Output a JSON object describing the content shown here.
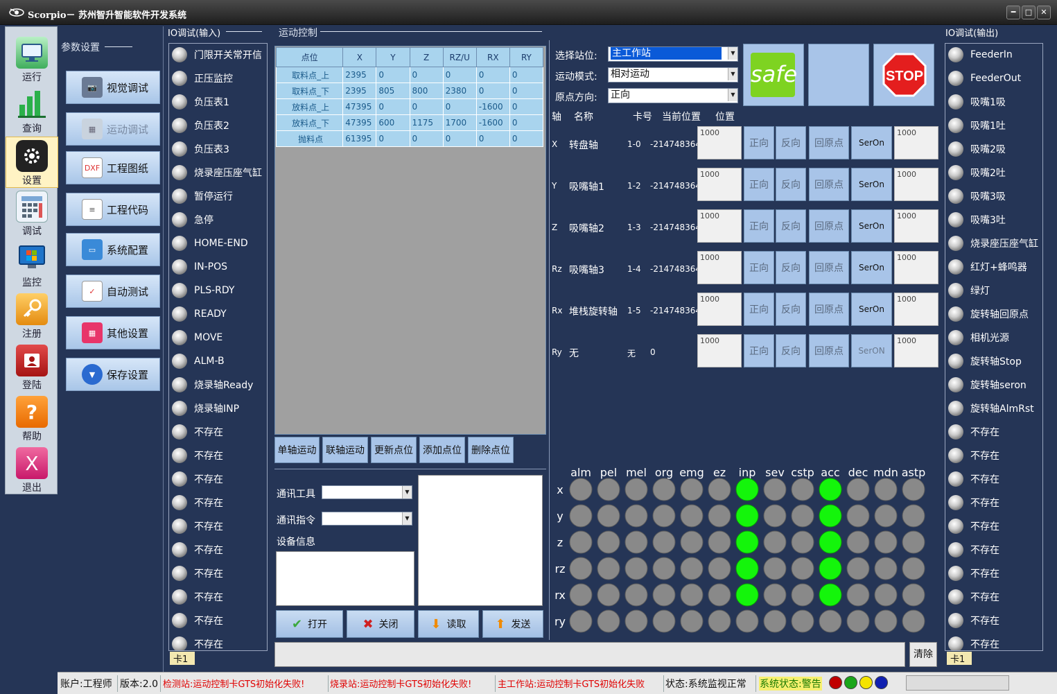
{
  "window": {
    "title": "Scorpio－ 苏州智升智能软件开发系统",
    "min": "━",
    "max": "□",
    "close": "✕"
  },
  "nav": [
    {
      "label": "运行",
      "icon": "monitor-icon"
    },
    {
      "label": "查询",
      "icon": "bar-chart-icon"
    },
    {
      "label": "设置",
      "icon": "gear-icon",
      "active": true
    },
    {
      "label": "调试",
      "icon": "calculator-icon"
    },
    {
      "label": "监控",
      "icon": "windows-monitor-icon"
    },
    {
      "label": "注册",
      "icon": "key-icon"
    },
    {
      "label": "登陆",
      "icon": "login-icon"
    },
    {
      "label": "帮助",
      "icon": "help-icon"
    },
    {
      "label": "退出",
      "icon": "exit-icon"
    }
  ],
  "params": {
    "title": "参数设置",
    "buttons": [
      "视觉调试",
      "运动调试",
      "工程图纸",
      "工程代码",
      "系统配置",
      "自动测试",
      "其他设置",
      "保存设置"
    ]
  },
  "io_in": {
    "title": "IO调试(输入)",
    "items": [
      "门限开关常开信",
      "正压监控",
      "负压表1",
      "负压表2",
      "负压表3",
      "烧录座压座气缸",
      "暂停运行",
      "急停",
      "HOME-END",
      "IN-POS",
      "PLS-RDY",
      "READY",
      "MOVE",
      "ALM-B",
      "烧录轴Ready",
      "烧录轴INP",
      "不存在",
      "不存在",
      "不存在",
      "不存在",
      "不存在",
      "不存在",
      "不存在",
      "不存在",
      "不存在",
      "不存在"
    ],
    "card": "卡1"
  },
  "motion": {
    "title": "运动控制",
    "table": {
      "headers": [
        "点位",
        "X",
        "Y",
        "Z",
        "RZ/U",
        "RX",
        "RY"
      ],
      "rows": [
        [
          "取料点_上",
          "2395",
          "0",
          "0",
          "0",
          "0",
          "0"
        ],
        [
          "取料点_下",
          "2395",
          "805",
          "800",
          "2380",
          "0",
          "0"
        ],
        [
          "放料点_上",
          "47395",
          "0",
          "0",
          "0",
          "-1600",
          "0"
        ],
        [
          "放料点_下",
          "47395",
          "600",
          "1175",
          "1700",
          "-1600",
          "0"
        ],
        [
          "抛料点",
          "61395",
          "0",
          "0",
          "0",
          "0",
          "0"
        ]
      ]
    },
    "buttons": [
      "单轴运动",
      "联轴运动",
      "更新点位",
      "添加点位",
      "删除点位"
    ]
  },
  "comm": {
    "tool_label": "通讯工具",
    "cmd_label": "通讯指令",
    "device_label": "设备信息",
    "tool_value": "",
    "cmd_value": "",
    "open": "打开",
    "close": "关闭",
    "read": "读取",
    "send": "发送"
  },
  "station": {
    "select_label": "选择站位:",
    "select_value": "主工作站",
    "mode_label": "运动模式:",
    "mode_value": "相对运动",
    "dir_label": "原点方向:",
    "dir_value": "正向",
    "safe_text": "safe",
    "stop_text": "STOP"
  },
  "axes": {
    "headers": [
      "轴",
      "名称",
      "卡号",
      "当前位置",
      "位置"
    ],
    "rows": [
      {
        "axis": "X",
        "name": "转盘轴",
        "card": "1-0",
        "pos": "-214748364",
        "val": "1000",
        "fwd": "正向",
        "rev": "反向",
        "home": "回原点",
        "seron": "SerOn",
        "val2": "1000"
      },
      {
        "axis": "Y",
        "name": "吸嘴轴1",
        "card": "1-2",
        "pos": "-214748364",
        "val": "1000",
        "fwd": "正向",
        "rev": "反向",
        "home": "回原点",
        "seron": "SerOn",
        "val2": "1000"
      },
      {
        "axis": "Z",
        "name": "吸嘴轴2",
        "card": "1-3",
        "pos": "-214748364",
        "val": "1000",
        "fwd": "正向",
        "rev": "反向",
        "home": "回原点",
        "seron": "SerOn",
        "val2": "1000"
      },
      {
        "axis": "Rz",
        "name": "吸嘴轴3",
        "card": "1-4",
        "pos": "-214748364",
        "val": "1000",
        "fwd": "正向",
        "rev": "反向",
        "home": "回原点",
        "seron": "SerOn",
        "val2": "1000"
      },
      {
        "axis": "Rx",
        "name": "堆栈旋转轴",
        "card": "1-5",
        "pos": "-214748364",
        "val": "1000",
        "fwd": "正向",
        "rev": "反向",
        "home": "回原点",
        "seron": "SerOn",
        "val2": "1000"
      },
      {
        "axis": "Ry",
        "name": "无",
        "card": "无",
        "pos": "0",
        "val": "1000",
        "fwd": "正向",
        "rev": "反向",
        "home": "回原点",
        "seron": "SerON",
        "val2": "1000"
      }
    ]
  },
  "status_grid": {
    "cols": [
      "alm",
      "pel",
      "mel",
      "org",
      "emg",
      "ez",
      "inp",
      "sev",
      "cstp",
      "acc",
      "dec",
      "mdn",
      "astp"
    ],
    "rows": [
      "x",
      "y",
      "z",
      "rz",
      "rx",
      "ry"
    ],
    "on": [
      [
        0,
        0,
        0,
        0,
        0,
        0,
        1,
        0,
        0,
        1,
        0,
        0,
        0
      ],
      [
        0,
        0,
        0,
        0,
        0,
        0,
        1,
        0,
        0,
        1,
        0,
        0,
        0
      ],
      [
        0,
        0,
        0,
        0,
        0,
        0,
        1,
        0,
        0,
        1,
        0,
        0,
        0
      ],
      [
        0,
        0,
        0,
        0,
        0,
        0,
        1,
        0,
        0,
        1,
        0,
        0,
        0
      ],
      [
        0,
        0,
        0,
        0,
        0,
        0,
        1,
        0,
        0,
        1,
        0,
        0,
        0
      ],
      [
        0,
        0,
        0,
        0,
        0,
        0,
        0,
        0,
        0,
        0,
        0,
        0,
        0
      ]
    ],
    "on_color": "#14f50b",
    "off_color": "#898989"
  },
  "log": {
    "value": "",
    "clear": "清除"
  },
  "io_out": {
    "title": "IO调试(输出)",
    "items": [
      "FeederIn",
      "FeederOut",
      "吸嘴1吸",
      "吸嘴1吐",
      "吸嘴2吸",
      "吸嘴2吐",
      "吸嘴3吸",
      "吸嘴3吐",
      "烧录座压座气缸",
      "红灯+蜂鸣器",
      "绿灯",
      "旋转轴回原点",
      "相机光源",
      "旋转轴Stop",
      "旋转轴seron",
      "旋转轴AlmRst",
      "不存在",
      "不存在",
      "不存在",
      "不存在",
      "不存在",
      "不存在",
      "不存在",
      "不存在",
      "不存在",
      "不存在"
    ],
    "card": "卡1"
  },
  "statusbar": {
    "account": "账户:工程师",
    "version": "版本:2.0",
    "err1": "检测站:运动控制卡GTS初始化失败!",
    "err2": "烧录站:运动控制卡GTS初始化失败!",
    "err3": "主工作站:运动控制卡GTS初始化失败",
    "state": "状态:系统监视正常",
    "sys_state": "系统状态:警告",
    "lights": [
      "#c00000",
      "#1aa51a",
      "#f5e400",
      "#1020b0"
    ],
    "progress": 0
  }
}
